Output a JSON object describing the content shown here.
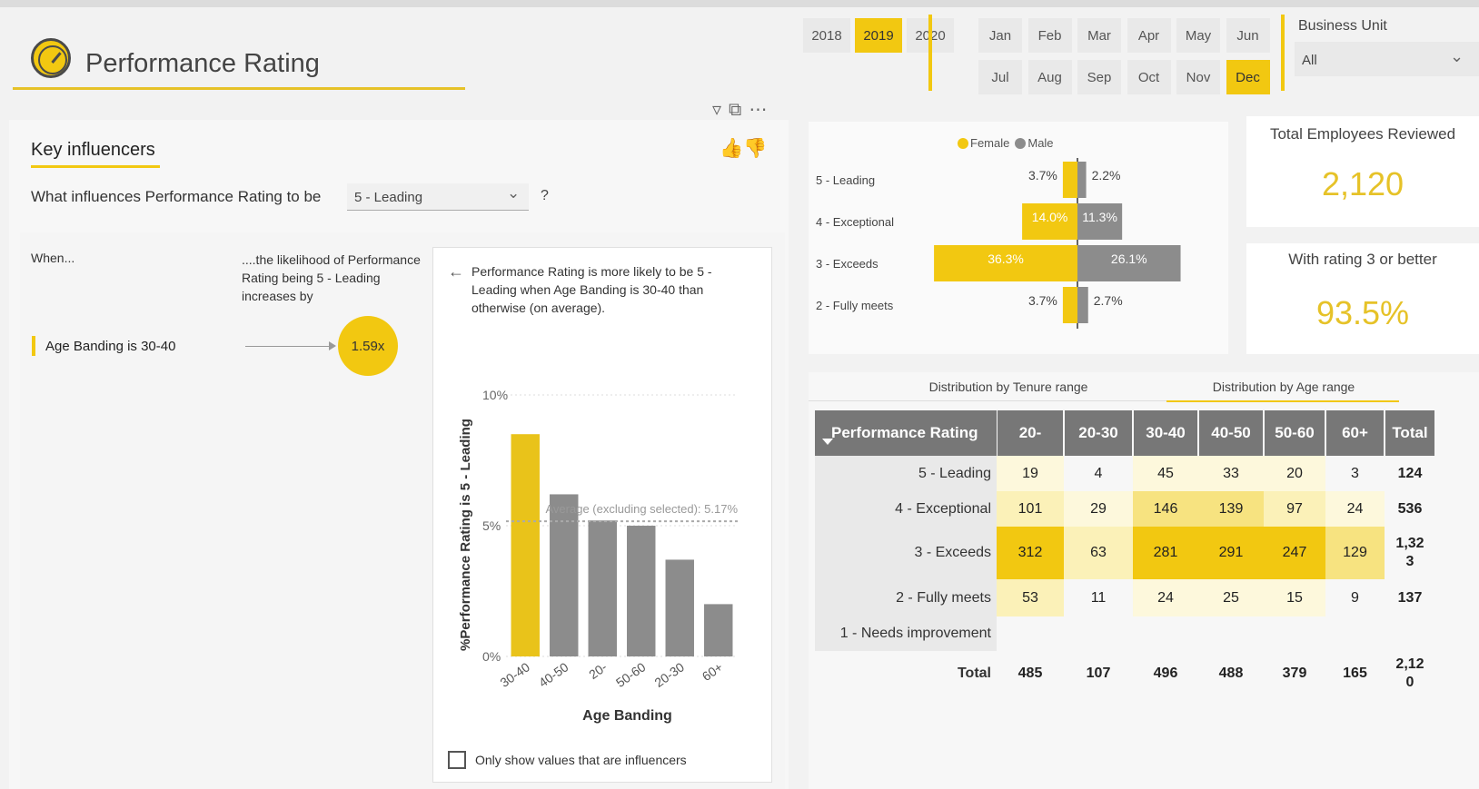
{
  "header": {
    "title": "Performance Rating"
  },
  "filters": {
    "years": [
      {
        "label": "2018",
        "selected": false
      },
      {
        "label": "2019",
        "selected": true
      },
      {
        "label": "2020",
        "selected": false
      }
    ],
    "months_row1": [
      {
        "label": "Jan",
        "selected": false
      },
      {
        "label": "Feb",
        "selected": false
      },
      {
        "label": "Mar",
        "selected": false
      },
      {
        "label": "Apr",
        "selected": false
      },
      {
        "label": "May",
        "selected": false
      },
      {
        "label": "Jun",
        "selected": false
      }
    ],
    "months_row2": [
      {
        "label": "Jul",
        "selected": false
      },
      {
        "label": "Aug",
        "selected": false
      },
      {
        "label": "Sep",
        "selected": false
      },
      {
        "label": "Oct",
        "selected": false
      },
      {
        "label": "Nov",
        "selected": false
      },
      {
        "label": "Dec",
        "selected": true
      }
    ],
    "business_unit": {
      "label": "Business Unit",
      "value": "All"
    }
  },
  "key_influencers": {
    "title": "Key influencers",
    "question_prefix": "What influences Performance Rating to be",
    "target_value": "5 - Leading",
    "question_suffix": "?",
    "when_label": "When...",
    "likelihood_label": "....the likelihood of Performance Rating being 5 - Leading increases by",
    "factor": {
      "label": "Age Banding is 30-40",
      "multiplier": "1.59x"
    },
    "detail": {
      "text": "Performance Rating is more likely to be 5 - Leading when Age Banding is 30-40 than otherwise (on average).",
      "checkbox_label": "Only show values that are influencers"
    }
  },
  "kpis": {
    "total_reviewed": {
      "title": "Total Employees Reviewed",
      "value": "2,120"
    },
    "rating3": {
      "title": "With rating 3 or better",
      "value": "93.5%"
    }
  },
  "distribution": {
    "tabs": [
      {
        "label": "Distribution by Tenure range",
        "active": false
      },
      {
        "label": "Distribution by Age range",
        "active": true
      }
    ],
    "matrix": {
      "row_header": "Performance Rating",
      "columns": [
        "20-",
        "20-30",
        "30-40",
        "40-50",
        "50-60",
        "60+",
        "Total"
      ],
      "rows": [
        {
          "label": "5 - Leading",
          "values": [
            "19",
            "4",
            "45",
            "33",
            "20",
            "3",
            "124"
          ]
        },
        {
          "label": "4 - Exceptional",
          "values": [
            "101",
            "29",
            "146",
            "139",
            "97",
            "24",
            "536"
          ]
        },
        {
          "label": "3 - Exceeds",
          "values": [
            "312",
            "63",
            "281",
            "291",
            "247",
            "129",
            "1,32 3"
          ]
        },
        {
          "label": "2 - Fully meets",
          "values": [
            "53",
            "11",
            "24",
            "25",
            "15",
            "9",
            "137"
          ]
        },
        {
          "label": "1 - Needs improvement",
          "values": [
            "",
            "",
            "",
            "",
            "",
            "",
            ""
          ]
        }
      ],
      "total_row": {
        "label": "Total",
        "values": [
          "485",
          "107",
          "496",
          "488",
          "379",
          "165",
          "2,12 0"
        ]
      },
      "heat_colors": {
        "none": "#f7f7f7",
        "l1": "#fdf8dc",
        "l2": "#fbf1b8",
        "l3": "#f7e380",
        "l4": "#f2c811"
      }
    }
  },
  "chart_data": [
    {
      "type": "bar",
      "title": "",
      "xlabel": "Age Banding",
      "ylabel": "%Performance Rating is 5 - Leading",
      "categories": [
        "30-40",
        "40-50",
        "20-",
        "50-60",
        "20-30",
        "60+"
      ],
      "values": [
        8.5,
        6.2,
        5.2,
        5.0,
        3.7,
        2.0
      ],
      "highlight_index": 0,
      "ylim": [
        0,
        10
      ],
      "yticks": [
        "0%",
        "5%",
        "10%"
      ],
      "average": {
        "value": 5.17,
        "label": "Average (excluding selected): 5.17%"
      },
      "colors": {
        "highlight": "#e9c31a",
        "other": "#8c8c8c"
      }
    },
    {
      "type": "bar",
      "orientation": "horizontal-diverging",
      "title": "",
      "categories": [
        "5 - Leading",
        "4 - Exceptional",
        "3 - Exceeds",
        "2 - Fully meets"
      ],
      "series": [
        {
          "name": "Female",
          "values": [
            3.7,
            14.0,
            36.3,
            3.7
          ],
          "labels": [
            "3.7%",
            "14.0%",
            "36.3%",
            "3.7%"
          ],
          "color": "#f2c811"
        },
        {
          "name": "Male",
          "values": [
            2.2,
            11.3,
            26.1,
            2.7
          ],
          "labels": [
            "2.2%",
            "11.3%",
            "26.1%",
            "2.7%"
          ],
          "color": "#8c8c8c"
        }
      ],
      "legend": "top"
    }
  ]
}
